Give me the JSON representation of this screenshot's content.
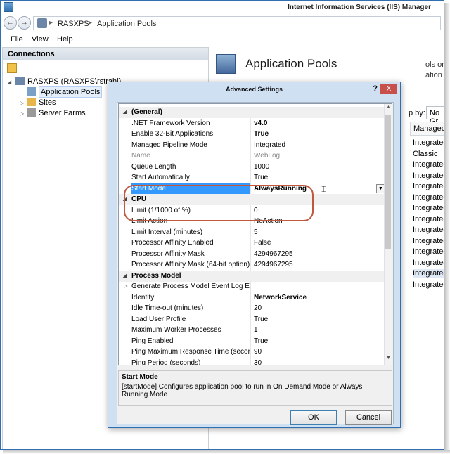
{
  "window": {
    "title": "Internet Information Services (IIS) Manager"
  },
  "address": {
    "crumbs": [
      "RASXPS",
      "Application Pools"
    ]
  },
  "menu": [
    "File",
    "View",
    "Help"
  ],
  "connections": {
    "header": "Connections",
    "tree": {
      "server": "RASXPS (RASXPS\\rstrahl)",
      "app_pools": "Application Pools",
      "sites": "Sites",
      "server_farms": "Server Farms"
    }
  },
  "pane": {
    "title": "Application Pools",
    "description_fragment": "ols on the se",
    "description_fragment2": "ation among",
    "group_by_label": "p by:",
    "group_by_value": "No Gr",
    "column_header": "Managed",
    "pipeline_values": [
      "Integrated",
      "Classic",
      "Integrated",
      "Integrated",
      "Integrated",
      "Integrated",
      "Integrated",
      "Integrated",
      "Integrated",
      "Integrated",
      "Integrated",
      "Integrated",
      "Integrated",
      "Integrated"
    ]
  },
  "dialog": {
    "title": "Advanced Settings",
    "help": "?",
    "close": "X",
    "properties": [
      {
        "type": "category",
        "name": "(General)"
      },
      {
        "name": ".NET Framework Version",
        "value": "v4.0",
        "bold": true
      },
      {
        "name": "Enable 32-Bit Applications",
        "value": "True",
        "bold": true
      },
      {
        "name": "Managed Pipeline Mode",
        "value": "Integrated"
      },
      {
        "name": "Name",
        "value": "WebLog",
        "gray": true
      },
      {
        "name": "Queue Length",
        "value": "1000"
      },
      {
        "name": "Start Automatically",
        "value": "True"
      },
      {
        "name": "Start Mode",
        "value": "AlwaysRunning",
        "bold": true,
        "selected": true
      },
      {
        "type": "category",
        "name": "CPU"
      },
      {
        "name": "Limit (1/1000 of %)",
        "value": "0"
      },
      {
        "name": "Limit Action",
        "value": "NoAction"
      },
      {
        "name": "Limit Interval (minutes)",
        "value": "5"
      },
      {
        "name": "Processor Affinity Enabled",
        "value": "False"
      },
      {
        "name": "Processor Affinity Mask",
        "value": "4294967295"
      },
      {
        "name": "Processor Affinity Mask (64-bit option)",
        "value": "4294967295"
      },
      {
        "type": "category",
        "name": "Process Model"
      },
      {
        "name": "Generate Process Model Event Log Entr",
        "value": "",
        "expandable": true
      },
      {
        "name": "Identity",
        "value": "NetworkService",
        "bold": true
      },
      {
        "name": "Idle Time-out (minutes)",
        "value": "20"
      },
      {
        "name": "Load User Profile",
        "value": "True"
      },
      {
        "name": "Maximum Worker Processes",
        "value": "1"
      },
      {
        "name": "Ping Enabled",
        "value": "True"
      },
      {
        "name": "Ping Maximum Response Time (secon",
        "value": "90"
      },
      {
        "name": "Ping Period (seconds)",
        "value": "30"
      }
    ],
    "description_title": "Start Mode",
    "description_text": "[startMode] Configures application pool to run in On Demand Mode or Always Running Mode",
    "ok_label": "OK",
    "cancel_label": "Cancel"
  },
  "colors": {
    "accent": "#2f6fb0",
    "selection": "#3399ff",
    "highlight_ring": "#c0573f"
  }
}
